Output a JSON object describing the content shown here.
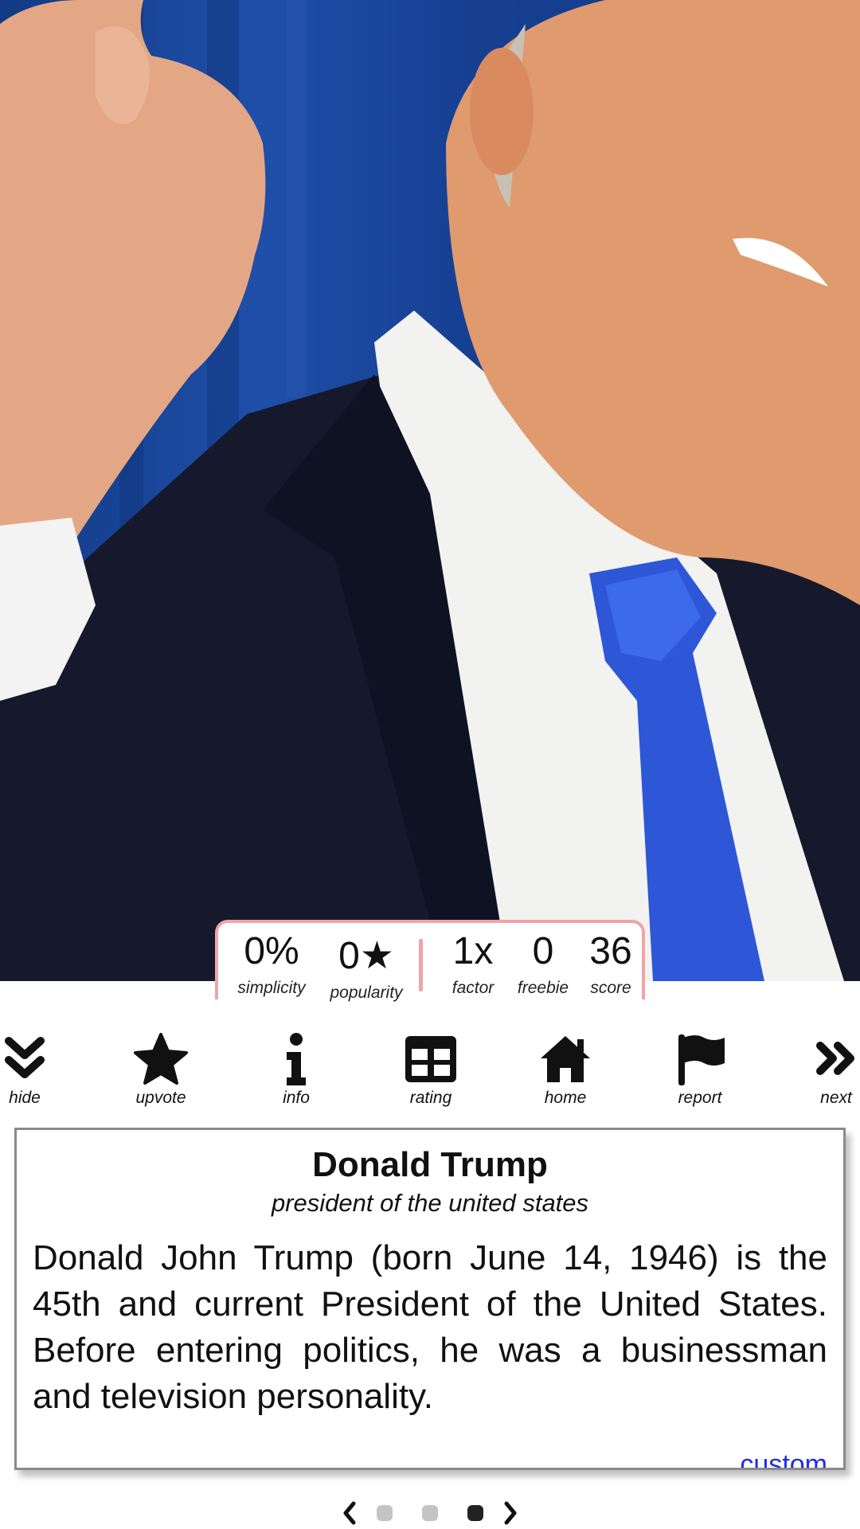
{
  "stats": {
    "simplicity": {
      "value": "0%",
      "label": "simplicity"
    },
    "popularity": {
      "value": "0★",
      "label": "popularity"
    },
    "factor": {
      "value": "1x",
      "label": "factor"
    },
    "freebie": {
      "value": "0",
      "label": "freebie"
    },
    "score": {
      "value": "36",
      "label": "score"
    }
  },
  "toolbar": {
    "items": [
      {
        "label": "hide",
        "icon": "double-chevron-down-icon"
      },
      {
        "label": "upvote",
        "icon": "star-icon"
      },
      {
        "label": "info",
        "icon": "info-icon"
      },
      {
        "label": "rating",
        "icon": "table-icon"
      },
      {
        "label": "home",
        "icon": "home-icon"
      },
      {
        "label": "report",
        "icon": "flag-icon"
      },
      {
        "label": "next",
        "icon": "double-chevron-right-icon"
      }
    ]
  },
  "card": {
    "title": "Donald Trump",
    "subtitle": "president of the united states",
    "description": "Donald John Trump (born June 14, 1946) is the 45th and current President of the United States. Before entering politics, he was a businessman and television personality.",
    "link_label": "custom"
  },
  "pager": {
    "pages": 3,
    "active_index": 2
  },
  "colors": {
    "stats_border": "#f0a4a8",
    "link": "#1d2de8",
    "card_border": "#8a8a8a",
    "dot_inactive": "#c4c4c4",
    "dot_active": "#222222"
  }
}
